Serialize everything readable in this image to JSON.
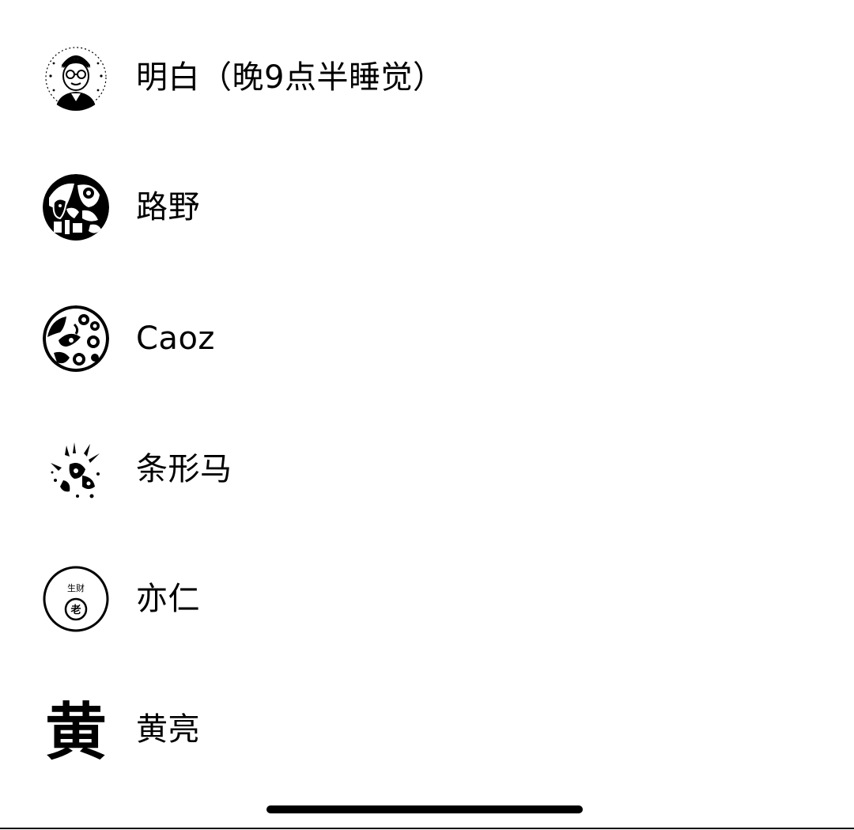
{
  "contacts": [
    {
      "name": "明白（晚9点半睡觉）",
      "avatar_icon": "cartoon-man-glasses-avatar"
    },
    {
      "name": "路野",
      "avatar_icon": "illustrated-portrait-avatar"
    },
    {
      "name": "Caoz",
      "avatar_icon": "abstract-pattern-avatar"
    },
    {
      "name": "条形马",
      "avatar_icon": "sketch-splash-avatar"
    },
    {
      "name": "亦仁",
      "avatar_icon": "circle-seal-avatar",
      "avatar_text": "生财",
      "avatar_seal": "老"
    },
    {
      "name": "黄亮",
      "avatar_icon": "calligraphy-character-avatar",
      "avatar_text": "黄"
    }
  ]
}
